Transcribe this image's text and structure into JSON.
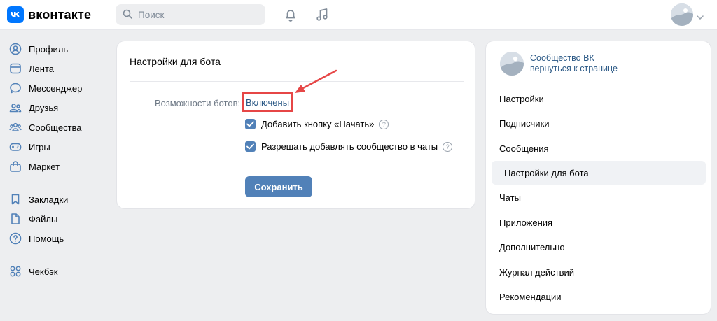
{
  "header": {
    "logo_text": "вконтакте",
    "search_placeholder": "Поиск",
    "icons": [
      "search-icon",
      "bell-icon",
      "music-icon",
      "chevron-down-icon"
    ]
  },
  "sidebar": {
    "items": [
      {
        "label": "Профиль",
        "icon": "profile-icon"
      },
      {
        "label": "Лента",
        "icon": "feed-icon"
      },
      {
        "label": "Мессенджер",
        "icon": "messenger-icon"
      },
      {
        "label": "Друзья",
        "icon": "friends-icon"
      },
      {
        "label": "Сообщества",
        "icon": "communities-icon"
      },
      {
        "label": "Игры",
        "icon": "games-icon"
      },
      {
        "label": "Маркет",
        "icon": "market-icon"
      },
      {
        "label": "Закладки",
        "icon": "bookmark-icon"
      },
      {
        "label": "Файлы",
        "icon": "file-icon"
      },
      {
        "label": "Помощь",
        "icon": "help-icon"
      },
      {
        "label": "Чекбэк",
        "icon": "checkback-icon"
      }
    ]
  },
  "main": {
    "title": "Настройки для бота",
    "field_label": "Возможности ботов:",
    "field_value": "Включены",
    "checkboxes": [
      {
        "label": "Добавить кнопку «Начать»",
        "checked": true
      },
      {
        "label": "Разрешать добавлять сообщество в чаты",
        "checked": true
      }
    ],
    "help_glyph": "?",
    "save_label": "Сохранить"
  },
  "right": {
    "community_name": "Сообщество ВК",
    "back_link": "вернуться к странице",
    "menu": [
      {
        "label": "Настройки",
        "active": false
      },
      {
        "label": "Подписчики",
        "active": false
      },
      {
        "label": "Сообщения",
        "active": false
      },
      {
        "label": "Настройки для бота",
        "active": true
      },
      {
        "label": "Чаты",
        "active": false
      },
      {
        "label": "Приложения",
        "active": false
      },
      {
        "label": "Дополнительно",
        "active": false
      },
      {
        "label": "Журнал действий",
        "active": false
      },
      {
        "label": "Рекомендации",
        "active": false
      }
    ]
  },
  "colors": {
    "accent": "#5181b8",
    "link": "#2a5885",
    "highlight_border": "#e64646",
    "background": "#edeef0"
  }
}
